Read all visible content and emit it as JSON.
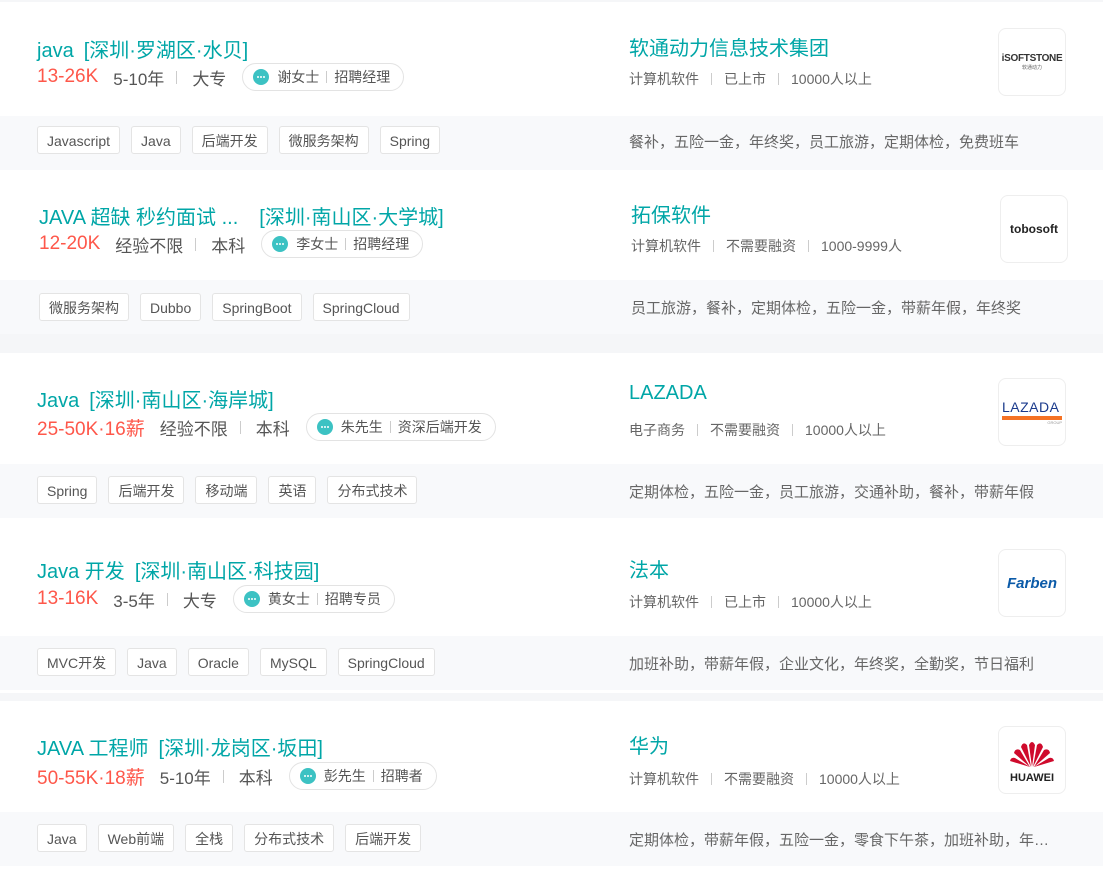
{
  "jobs": [
    {
      "title": "java",
      "location": "[深圳·罗湖区·水贝]",
      "salary": "13-26K",
      "experience": "5-10年",
      "education": "大专",
      "recruiter_name": "谢女士",
      "recruiter_role": "招聘经理",
      "company": "软通动力信息技术集团",
      "industry": "计算机软件",
      "stage": "已上市",
      "size": "10000人以上",
      "logo_text": "iSOFTSTONE",
      "logo_subtext": "软通动力",
      "skills": [
        "Javascript",
        "Java",
        "后端开发",
        "微服务架构",
        "Spring"
      ],
      "welfare": "餐补，五险一金，年终奖，员工旅游，定期体检，免费班车"
    },
    {
      "title": "JAVA 超缺 秒约面试 ...",
      "location": "[深圳·南山区·大学城]",
      "salary": "12-20K",
      "experience": "经验不限",
      "education": "本科",
      "recruiter_name": "李女士",
      "recruiter_role": "招聘经理",
      "company": "拓保软件",
      "industry": "计算机软件",
      "stage": "不需要融资",
      "size": "1000-9999人",
      "logo_text": "tobosoft",
      "skills": [
        "微服务架构",
        "Dubbo",
        "SpringBoot",
        "SpringCloud"
      ],
      "welfare": "员工旅游，餐补，定期体检，五险一金，带薪年假，年终奖"
    },
    {
      "title": "Java",
      "location": "[深圳·南山区·海岸城]",
      "salary": "25-50K·16薪",
      "experience": "经验不限",
      "education": "本科",
      "recruiter_name": "朱先生",
      "recruiter_role": "资深后端开发",
      "company": "LAZADA",
      "industry": "电子商务",
      "stage": "不需要融资",
      "size": "10000人以上",
      "logo_text": "LAZADA",
      "logo_subtext": "GROUP",
      "skills": [
        "Spring",
        "后端开发",
        "移动端",
        "英语",
        "分布式技术"
      ],
      "welfare": "定期体检，五险一金，员工旅游，交通补助，餐补，带薪年假"
    },
    {
      "title": "Java 开发",
      "location": "[深圳·南山区·科技园]",
      "salary": "13-16K",
      "experience": "3-5年",
      "education": "大专",
      "recruiter_name": "黄女士",
      "recruiter_role": "招聘专员",
      "company": "法本",
      "industry": "计算机软件",
      "stage": "已上市",
      "size": "10000人以上",
      "logo_text": "Farben",
      "skills": [
        "MVC开发",
        "Java",
        "Oracle",
        "MySQL",
        "SpringCloud"
      ],
      "welfare": "加班补助，带薪年假，企业文化，年终奖，全勤奖，节日福利"
    },
    {
      "title": "JAVA 工程师",
      "location": "[深圳·龙岗区·坂田]",
      "salary": "50-55K·18薪",
      "experience": "5-10年",
      "education": "本科",
      "recruiter_name": "彭先生",
      "recruiter_role": "招聘者",
      "company": "华为",
      "industry": "计算机软件",
      "stage": "不需要融资",
      "size": "10000人以上",
      "logo_text": "HUAWEI",
      "skills": [
        "Java",
        "Web前端",
        "全栈",
        "分布式技术",
        "后端开发"
      ],
      "welfare": "定期体检，带薪年假，五险一金，零食下午茶，加班补助，年终奖"
    }
  ],
  "colors": {
    "title": "#00a6a7",
    "salary": "#fe574a",
    "chat": "#3cc2c3",
    "huawei_red": "#cf0a2c",
    "lazada_orange": "#f57224",
    "farben_blue": "#0a5aa8"
  }
}
